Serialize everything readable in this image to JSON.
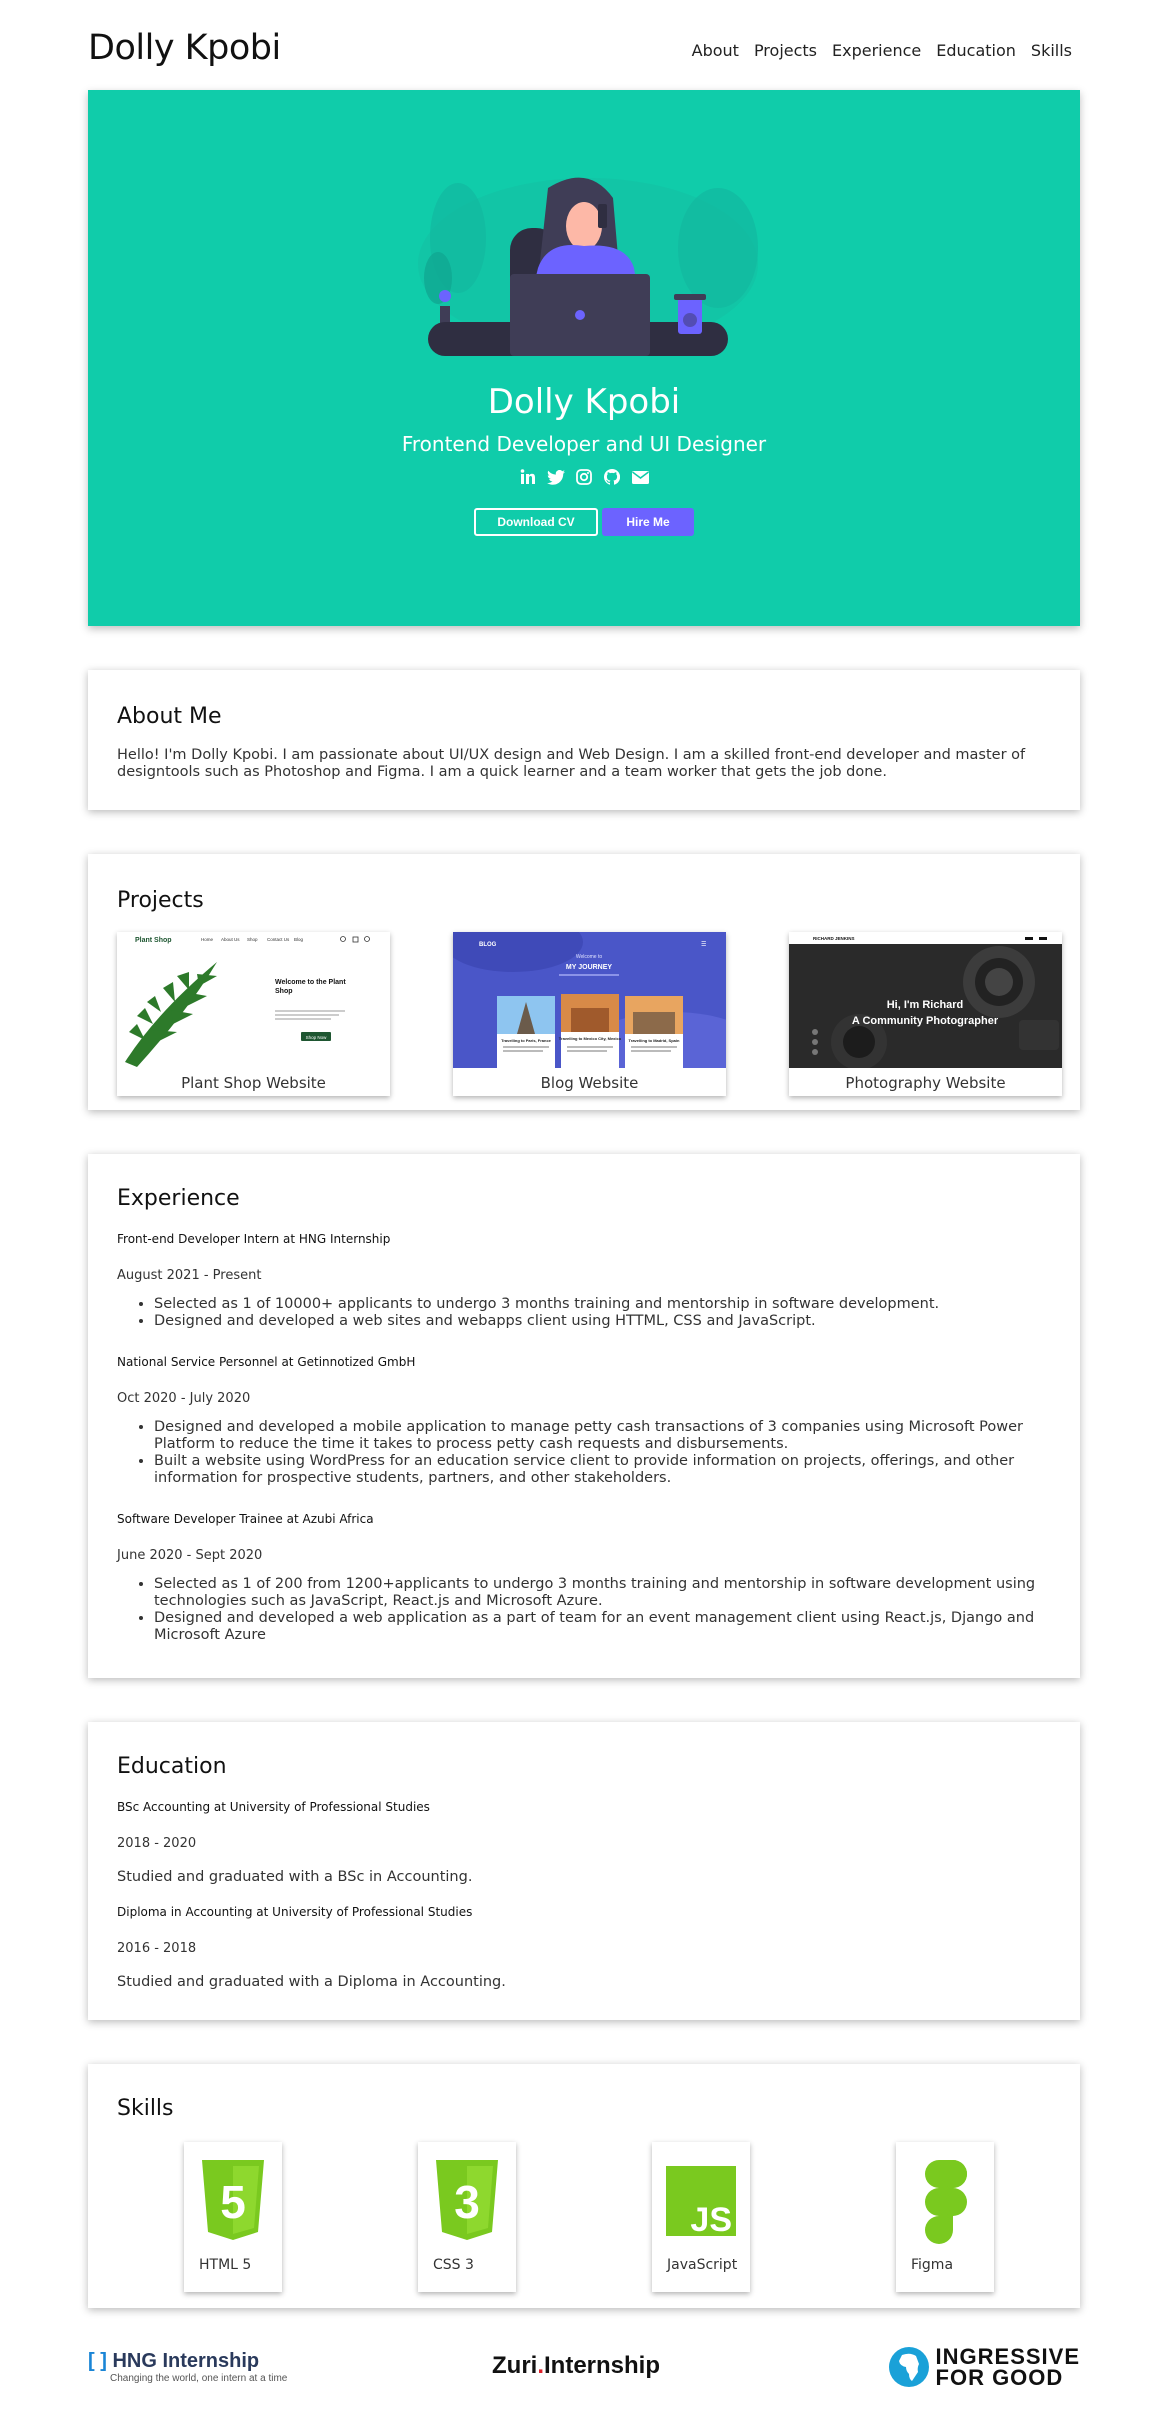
{
  "header": {
    "brand": "Dolly Kpobi",
    "nav": [
      "About",
      "Projects",
      "Experience",
      "Education",
      "Skills"
    ]
  },
  "hero": {
    "name": "Dolly Kpobi",
    "role": "Frontend Developer and UI Designer",
    "socials": [
      "linkedin-icon",
      "twitter-icon",
      "instagram-icon",
      "github-icon",
      "envelope-icon"
    ],
    "download_cv": "Download CV",
    "hire_me": "Hire Me",
    "colors": {
      "background": "#10ccaa",
      "accent": "#6c63ff"
    }
  },
  "about": {
    "title": "About Me",
    "text": "Hello! I'm Dolly Kpobi. I am passionate about UI/UX design and Web Design. I am a skilled front-end developer and master of designtools such as Photoshop and Figma. I am a quick learner and a team worker that gets the job done."
  },
  "projects": {
    "title": "Projects",
    "items": [
      {
        "caption": "Plant Shop Website",
        "thumb": {
          "logo": "Plant Shop",
          "nav": [
            "Home",
            "About Us",
            "Shop",
            "Contact Us",
            "Blog"
          ],
          "heading": "Welcome to the Plant Shop",
          "button": "Shop Now"
        }
      },
      {
        "caption": "Blog Website",
        "thumb": {
          "logo": "BLOG",
          "subtitle": "Welcome to",
          "heading": "MY JOURNEY",
          "posts": [
            "Travelling to Paris, France",
            "Travelling to Mexico City, Mexico",
            "Travelling to Madrid, Spain"
          ]
        }
      },
      {
        "caption": "Photography Website",
        "thumb": {
          "logo": "RICHARD JENKINS",
          "greeting": "Hi, I'm Richard",
          "heading": "A Community Photographer"
        }
      }
    ]
  },
  "experience": {
    "title": "Experience",
    "items": [
      {
        "role": "Front-end Developer Intern at HNG Internship",
        "date": "August 2021 - Present",
        "bullets": [
          "Selected as 1 of 10000+ applicants to undergo 3 months training and mentorship in software development.",
          "Designed and developed a web sites and webapps client using HTTML, CSS and JavaScript."
        ]
      },
      {
        "role": "National Service Personnel at Getinnotized GmbH",
        "date": "Oct 2020 - July 2020",
        "bullets": [
          "Designed and developed a mobile application to manage petty cash transactions of 3 companies using Microsoft Power Platform to reduce the time it takes to process petty cash requests and disbursements.",
          "Built a website using WordPress for an education service client to provide information on projects, offerings, and other information for prospective students, partners, and other stakeholders."
        ]
      },
      {
        "role": "Software Developer Trainee at Azubi Africa",
        "date": "June 2020 - Sept 2020",
        "bullets": [
          "Selected as 1 of 200 from 1200+applicants to undergo 3 months training and mentorship in software development using technologies such as JavaScript, React.js and Microsoft Azure.",
          "Designed and developed a web application as a part of team for an event management client using React.js, Django and Microsoft Azure"
        ]
      }
    ]
  },
  "education": {
    "title": "Education",
    "items": [
      {
        "degree": "BSc Accounting at University of Professional Studies",
        "date": "2018 - 2020",
        "desc": "Studied and graduated with a BSc in Accounting."
      },
      {
        "degree": "Diploma in Accounting at University of Professional Studies",
        "date": "2016 - 2018",
        "desc": "Studied and graduated with a Diploma in Accounting."
      }
    ]
  },
  "skills": {
    "title": "Skills",
    "items": [
      {
        "label": "HTML 5",
        "icon": "html5-icon",
        "logo_text": "5"
      },
      {
        "label": "CSS 3",
        "icon": "css3-icon",
        "logo_text": "3"
      },
      {
        "label": "JavaScript",
        "icon": "javascript-icon",
        "logo_text": "JS"
      },
      {
        "label": "Figma",
        "icon": "figma-icon"
      }
    ],
    "color": "#7ac91f"
  },
  "footer": {
    "hng": {
      "name": "HNG Internship",
      "tagline": "Changing the world, one intern at a time"
    },
    "zuri": {
      "name_start": "Zuri",
      "dot": ".",
      "name_end": "Internship"
    },
    "i4g": {
      "line1": "INGRESSIVE",
      "line2": "FOR GOOD"
    }
  }
}
